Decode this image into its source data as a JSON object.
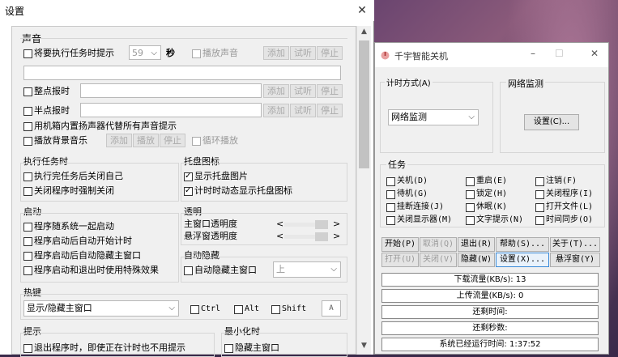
{
  "settings": {
    "title": "设置",
    "close_glyph": "✕",
    "sound": {
      "heading": "声音",
      "pre_alert_label": "将要执行任务时提示",
      "pre_alert_seconds": "59",
      "seconds_unit": "秒",
      "play_sound_label": "播放声音",
      "add": "添加",
      "listen": "试听",
      "stop": "停止",
      "hourly_label": "整点报时",
      "half_hourly_label": "半点报时",
      "speaker_label": "用机箱内置扬声器代替所有声音提示",
      "bg_music_label": "播放背景音乐",
      "play": "播放",
      "loop_label": "循环播放"
    },
    "exec": {
      "heading": "执行任务时",
      "close_self": "执行完任务后关闭自己",
      "force_close": "关闭程序时强制关闭"
    },
    "tray": {
      "heading": "托盘图标",
      "show_tray": "显示托盘图片",
      "animate": "计时时动态显示托盘图标"
    },
    "startup": {
      "heading": "启动",
      "with_system": "程序随系统一起启动",
      "auto_timer": "程序启动后自动开始计时",
      "auto_hide": "程序启动后自动隐藏主窗口",
      "effects": "程序启动和退出时使用特殊效果"
    },
    "opacity": {
      "heading": "透明",
      "main_label": "主窗口透明度",
      "float_label": "悬浮窗透明度",
      "lt": "<",
      "gt": ">"
    },
    "autohide": {
      "heading": "自动隐藏",
      "label": "自动隐藏主窗口",
      "position": "上"
    },
    "hotkey": {
      "heading": "热键",
      "action": "显示/隐藏主窗口",
      "ctrl": "Ctrl",
      "alt": "Alt",
      "shift": "Shift",
      "key": "A"
    },
    "prompt": {
      "heading": "提示",
      "exit_label": "退出程序时，即使正在计时也不用提示"
    },
    "minimize": {
      "heading": "最小化时",
      "hide_label": "隐藏主窗口"
    }
  },
  "app": {
    "title": "千宇智能关机",
    "timing": {
      "heading": "计时方式(A)",
      "value": "网络监测"
    },
    "net": {
      "heading": "网络监测",
      "setup": "设置(C)..."
    },
    "tasks": {
      "heading": "任务",
      "items": [
        "关机(D)",
        "重启(E)",
        "注销(F)",
        "待机(G)",
        "锁定(H)",
        "关闭程序(I)",
        "挂断连接(J)",
        "休眠(K)",
        "打开文件(L)",
        "关闭显示器(M)",
        "文字提示(N)",
        "时间同步(O)"
      ]
    },
    "buttons": {
      "start": "开始(P)",
      "cancel": "取消(Q)",
      "exit": "退出(R)",
      "help": "帮助(S)...",
      "about": "关于(T)...",
      "open": "打开(U)",
      "close": "关闭(V)",
      "hide": "隐藏(W)",
      "settings": "设置(X)...",
      "float": "悬浮窗(Y)"
    },
    "status": {
      "download": "下载流量(KB/s): 13",
      "upload": "上传流量(KB/s): 0",
      "remain_time": "还剩时间:",
      "remain_sec": "还剩秒数:",
      "uptime": "系统已经运行时间: 1:37:52"
    }
  },
  "colors": {
    "accent": "#3a8ad8"
  }
}
